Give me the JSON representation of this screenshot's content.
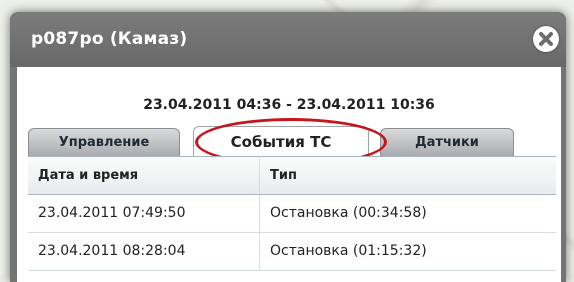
{
  "window": {
    "title": "р087ро (Камаз)",
    "close_icon": "close-icon"
  },
  "period": "23.04.2011 04:36 - 23.04.2011 10:36",
  "tabs": [
    {
      "label": "Управление",
      "active": false
    },
    {
      "label": "События ТС",
      "active": true
    },
    {
      "label": "Датчики",
      "active": false
    }
  ],
  "table": {
    "columns": [
      "Дата и время",
      "Тип"
    ],
    "rows": [
      [
        "23.04.2011 07:49:50",
        "Остановка (00:34:58)"
      ],
      [
        "23.04.2011 08:28:04",
        "Остановка (01:15:32)"
      ]
    ]
  },
  "colors": {
    "titlebar": "#747474",
    "highlight": "#c4161c"
  }
}
